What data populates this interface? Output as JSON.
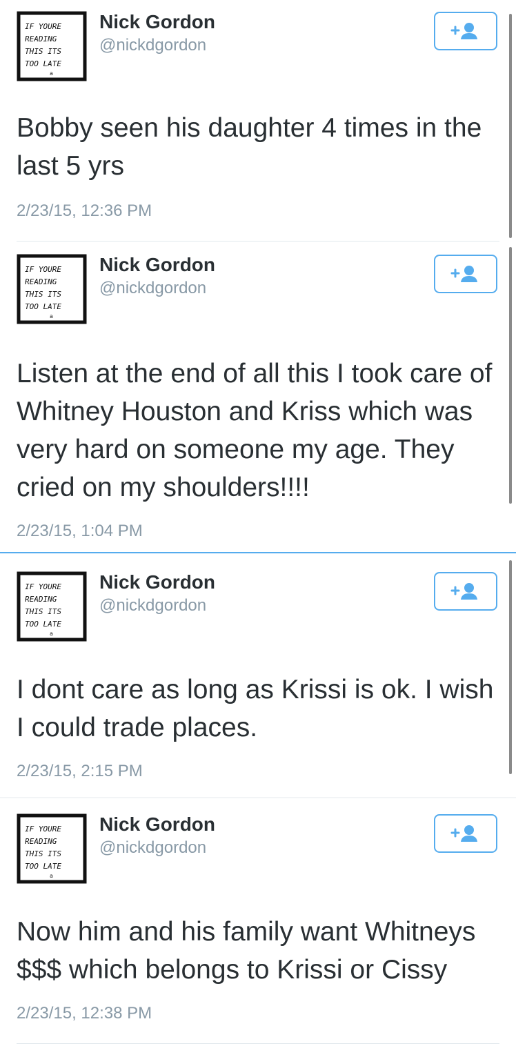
{
  "tweets": [
    {
      "name": "Nick Gordon",
      "handle": "@nickdgordon",
      "text": "Bobby seen his daughter 4 times in the last 5 yrs",
      "timestamp": "2/23/15, 12:36 PM",
      "follow_icon": "follow-person-plus-icon"
    },
    {
      "name": "Nick Gordon",
      "handle": "@nickdgordon",
      "text": "Listen at the end of all this I took care of Whitney Houston and Kriss which was very hard on someone my age. They cried on my shoulders!!!!",
      "timestamp": "2/23/15, 1:04 PM",
      "follow_icon": "follow-person-plus-icon"
    },
    {
      "name": "Nick Gordon",
      "handle": "@nickdgordon",
      "text": "I dont care as long as Krissi is ok. I wish I could trade places.",
      "timestamp": "2/23/15, 2:15 PM",
      "follow_icon": "follow-person-plus-icon"
    },
    {
      "name": "Nick Gordon",
      "handle": "@nickdgordon",
      "text": "Now him and his family want Whitneys $$$ which belongs to Krissi or Cissy",
      "timestamp": "2/23/15, 12:38 PM",
      "follow_icon": "follow-person-plus-icon"
    }
  ],
  "avatar_art": {
    "lines": [
      "IF YOURE",
      "READING",
      "THIS ITS",
      "TOO LATE"
    ],
    "small_mark": "a"
  },
  "colors": {
    "accent": "#55acee",
    "text": "#292f33",
    "muted": "#8899a6",
    "divider": "#e1e8ed"
  }
}
